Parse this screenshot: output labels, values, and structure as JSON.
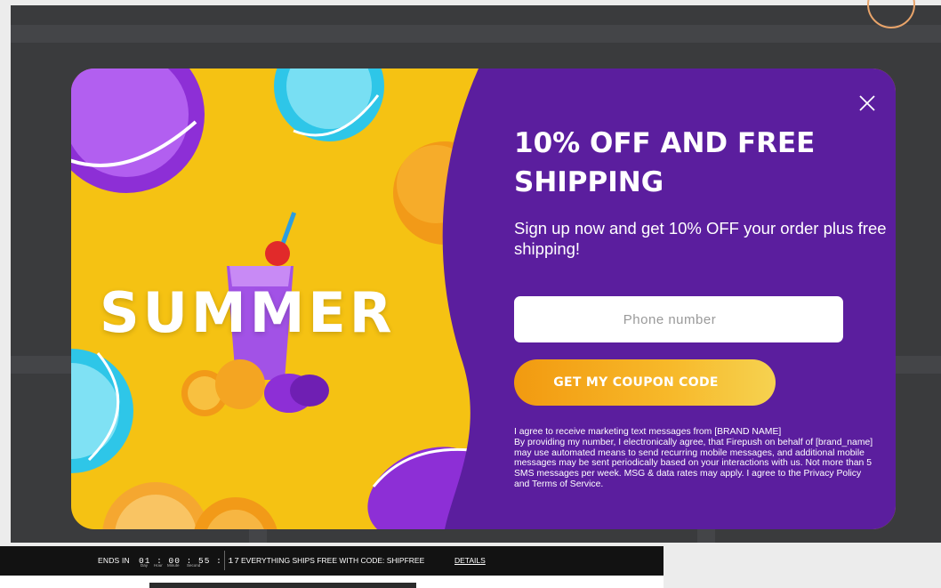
{
  "popup": {
    "art_word": "SUMMER",
    "headline": "10% OFF AND FREE SHIPPING",
    "subtext": "Sign up now and get 10% OFF your order plus free shipping!",
    "phone_placeholder": "Phone number",
    "cta_label": "GET MY COUPON CODE",
    "consent_line1": "I agree to receive marketing text messages from [BRAND NAME]",
    "consent_body": "By providing my number, I electronically agree, that Firepush on behalf of [brand_name] may use automated means to send recurring mobile messages, and additional mobile messages may be sent periodically based on your interactions with us. Not more than 5 SMS messages per week. MSG & data rates may apply. I agree to the Privacy Policy and Terms of Service.",
    "close_icon": "close-icon",
    "colors": {
      "panel": "#5b1e9e",
      "art_bg": "#f5c213",
      "button_start": "#f29a10",
      "button_end": "#f6d250"
    }
  },
  "promo_bar": {
    "ends_label": "ENDS IN",
    "countdown": "01 : 00 : 55 : 17",
    "unit_day": "Day",
    "unit_hour": "Hour",
    "unit_minute": "Minute",
    "unit_second": "Second",
    "shipping_text": "EVERYTHING SHIPS FREE WITH CODE: SHIPFREE",
    "details_link": "DETAILS"
  }
}
